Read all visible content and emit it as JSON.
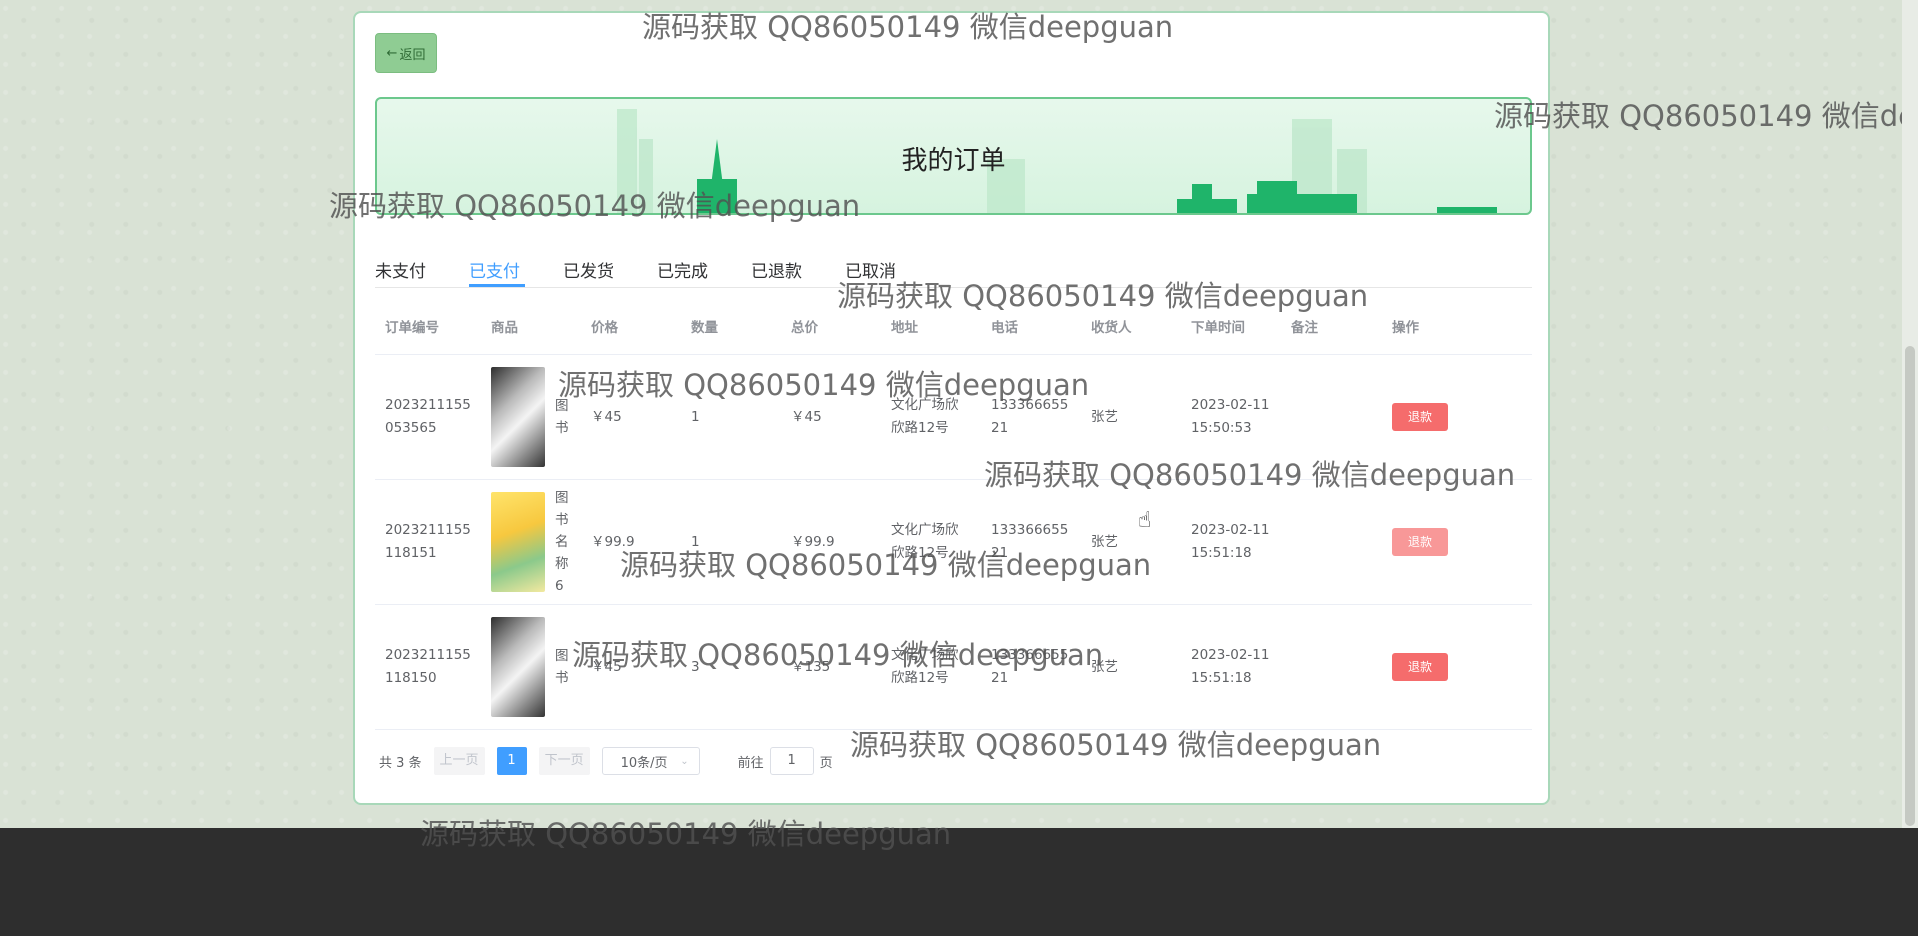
{
  "back_button": {
    "arrow": "←",
    "label": "返回"
  },
  "page_title": "我的订单",
  "tabs": [
    "未支付",
    "已支付",
    "已发货",
    "已完成",
    "已退款",
    "已取消"
  ],
  "active_tab": "已支付",
  "table": {
    "headers": [
      "订单编号",
      "商品",
      "价格",
      "数量",
      "总价",
      "地址",
      "电话",
      "收货人",
      "下单时间",
      "备注",
      "操作"
    ],
    "rows": [
      {
        "order_no_1": "2023211155",
        "order_no_2": "053565",
        "goods_name": "图书",
        "price": "￥45",
        "qty": "1",
        "total": "￥45",
        "addr_1": "文化广场欣",
        "addr_2": "欣路12号",
        "phone_1": "133366655",
        "phone_2": "21",
        "receiver": "张艺",
        "time_1": "2023-02-11",
        "time_2": "15:50:53",
        "note": "",
        "action": "退款"
      },
      {
        "order_no_1": "2023211155",
        "order_no_2": "118151",
        "goods_name": "图书名称6",
        "price": "￥99.9",
        "qty": "1",
        "total": "￥99.9",
        "addr_1": "文化广场欣",
        "addr_2": "欣路12号",
        "phone_1": "133366655",
        "phone_2": "21",
        "receiver": "张艺",
        "time_1": "2023-02-11",
        "time_2": "15:51:18",
        "note": "",
        "action": "退款"
      },
      {
        "order_no_1": "2023211155",
        "order_no_2": "118150",
        "goods_name": "图书",
        "price": "￥45",
        "qty": "3",
        "total": "￥135",
        "addr_1": "文化广场欣",
        "addr_2": "欣路12号",
        "phone_1": "133366655",
        "phone_2": "21",
        "receiver": "张艺",
        "time_1": "2023-02-11",
        "time_2": "15:51:18",
        "note": "",
        "action": "退款"
      }
    ]
  },
  "pagination": {
    "total": "共 3 条",
    "prev": "上一页",
    "current": "1",
    "next": "下一页",
    "page_size": "10条/页",
    "goto_prefix": "前往",
    "goto_value": "1",
    "goto_suffix": "页"
  },
  "watermark": "源码获取 QQ86050149 微信deepguan",
  "colors": {
    "accent": "#409eff",
    "danger": "#f56c6c",
    "back_button": "#8fcc93"
  }
}
